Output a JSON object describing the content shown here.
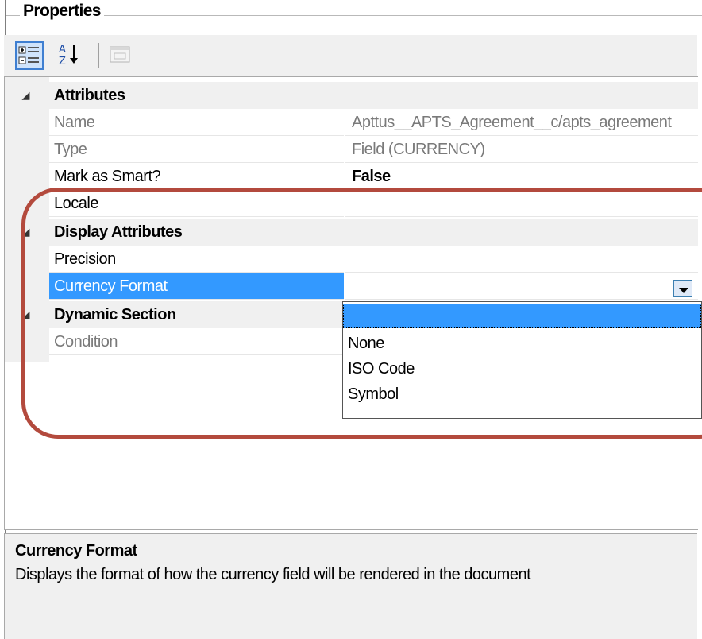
{
  "panel": {
    "title": "Properties"
  },
  "toolbar": {
    "categorized_icon": "categorized-icon",
    "alphabetical_icon": "sort-alphabetical-icon",
    "property_pages_icon": "property-pages-icon"
  },
  "grid": {
    "categories": [
      {
        "label": "Attributes",
        "properties": [
          {
            "name": "Name",
            "value": "Apttus__APTS_Agreement__c/apts_agreement"
          },
          {
            "name": "Type",
            "value": "Field (CURRENCY)"
          },
          {
            "name": "Mark as Smart?",
            "value": "False"
          },
          {
            "name": "Locale",
            "value": ""
          }
        ]
      },
      {
        "label": "Display Attributes",
        "properties": [
          {
            "name": "Precision",
            "value": ""
          },
          {
            "name": "Currency Format",
            "value": ""
          }
        ]
      },
      {
        "label": "Dynamic Section",
        "properties": [
          {
            "name": "Condition",
            "value": ""
          }
        ]
      }
    ]
  },
  "dropdown": {
    "options": [
      "",
      "None",
      "ISO Code",
      "Symbol"
    ]
  },
  "help": {
    "title": "Currency Format",
    "description": "Displays the format of how the currency field will be rendered in the document"
  },
  "colors": {
    "selection": "#3399ff",
    "annotation_oval": "#b34a3d"
  }
}
